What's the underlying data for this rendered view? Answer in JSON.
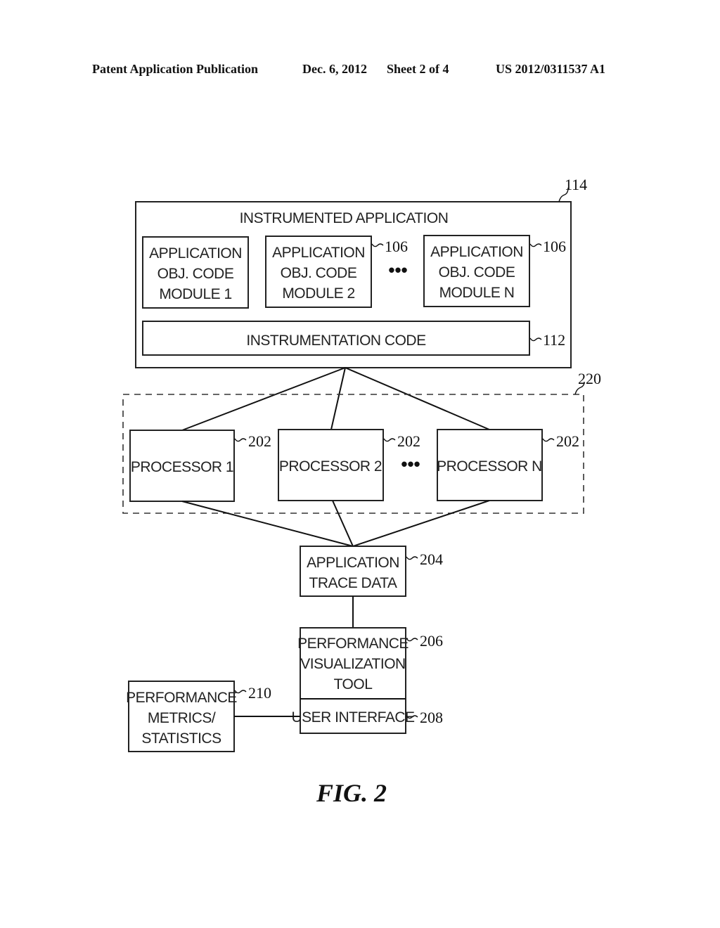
{
  "header": {
    "publication": "Patent Application Publication",
    "date": "Dec. 6, 2012",
    "sheet": "Sheet 2 of 4",
    "number": "US 2012/0311537 A1"
  },
  "diagram": {
    "instrumented_application": {
      "title": "INSTRUMENTED APPLICATION",
      "ref": "114",
      "modules": [
        {
          "lines": [
            "APPLICATION",
            "OBJ. CODE",
            "MODULE 1"
          ],
          "ref": ""
        },
        {
          "lines": [
            "APPLICATION",
            "OBJ. CODE",
            "MODULE 2"
          ],
          "ref": "106"
        },
        {
          "lines": [
            "APPLICATION",
            "OBJ. CODE",
            "MODULE N"
          ],
          "ref": "106"
        }
      ],
      "ellipsis": "•••",
      "instrumentation_code": {
        "label": "INSTRUMENTATION CODE",
        "ref": "112"
      }
    },
    "processor_group": {
      "ref": "220",
      "processors": [
        {
          "label": "PROCESSOR 1",
          "ref": "202"
        },
        {
          "label": "PROCESSOR 2",
          "ref": "202"
        },
        {
          "label": "PROCESSOR N",
          "ref": "202"
        }
      ],
      "ellipsis": "•••"
    },
    "trace_data": {
      "lines": [
        "APPLICATION",
        "TRACE DATA"
      ],
      "ref": "204"
    },
    "visualization_tool": {
      "lines": [
        "PERFORMANCE",
        "VISUALIZATION",
        "TOOL"
      ],
      "ref": "206"
    },
    "user_interface": {
      "label": "USER INTERFACE",
      "ref": "208"
    },
    "metrics": {
      "lines": [
        "PERFORMANCE",
        "METRICS/",
        "STATISTICS"
      ],
      "ref": "210"
    }
  },
  "figure_label": "FIG. 2"
}
